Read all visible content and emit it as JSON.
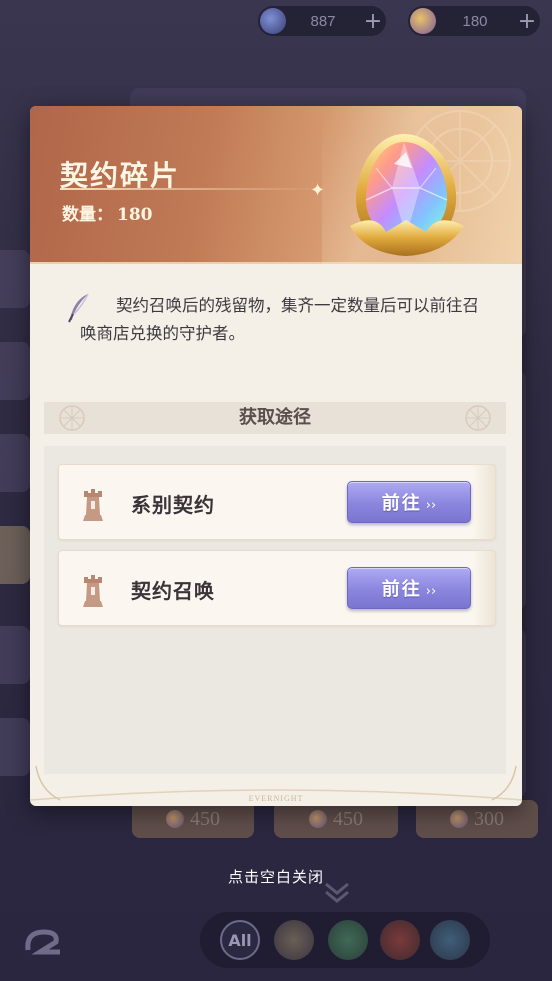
{
  "top_bar": {
    "currency_1": {
      "value": "887",
      "icon": "star-orb-icon",
      "plus": "+"
    },
    "currency_2": {
      "value": "180",
      "icon": "crystal-shard-icon",
      "plus": "+"
    }
  },
  "background": {
    "prices": [
      "450",
      "450",
      "300"
    ]
  },
  "modal": {
    "title": "契约碎片",
    "quantity_label": "数量：",
    "quantity_value": "180",
    "item_icon": "rainbow-crystal-shard-icon",
    "description": "契约召唤后的残留物，集齐一定数量后可以前往召唤商店兑换的守护者。",
    "section_title": "获取途径",
    "routes": [
      {
        "label": "系别契约",
        "button": "前往",
        "icon": "tower-emblem-icon"
      },
      {
        "label": "契约召唤",
        "button": "前往",
        "icon": "tower-emblem-icon"
      }
    ],
    "footer_brand": "EVERNIGHT"
  },
  "close_hint": "点击空白关闭",
  "bottom_nav": {
    "all_label": "All",
    "filters": [
      "mountain-icon",
      "swirl-icon",
      "flame-icon",
      "snowflake-icon"
    ]
  },
  "colors": {
    "header_start": "#b0664a",
    "header_end": "#f0d2ad",
    "button_purple": "#8a86de",
    "modal_bg": "#f4efe7"
  }
}
